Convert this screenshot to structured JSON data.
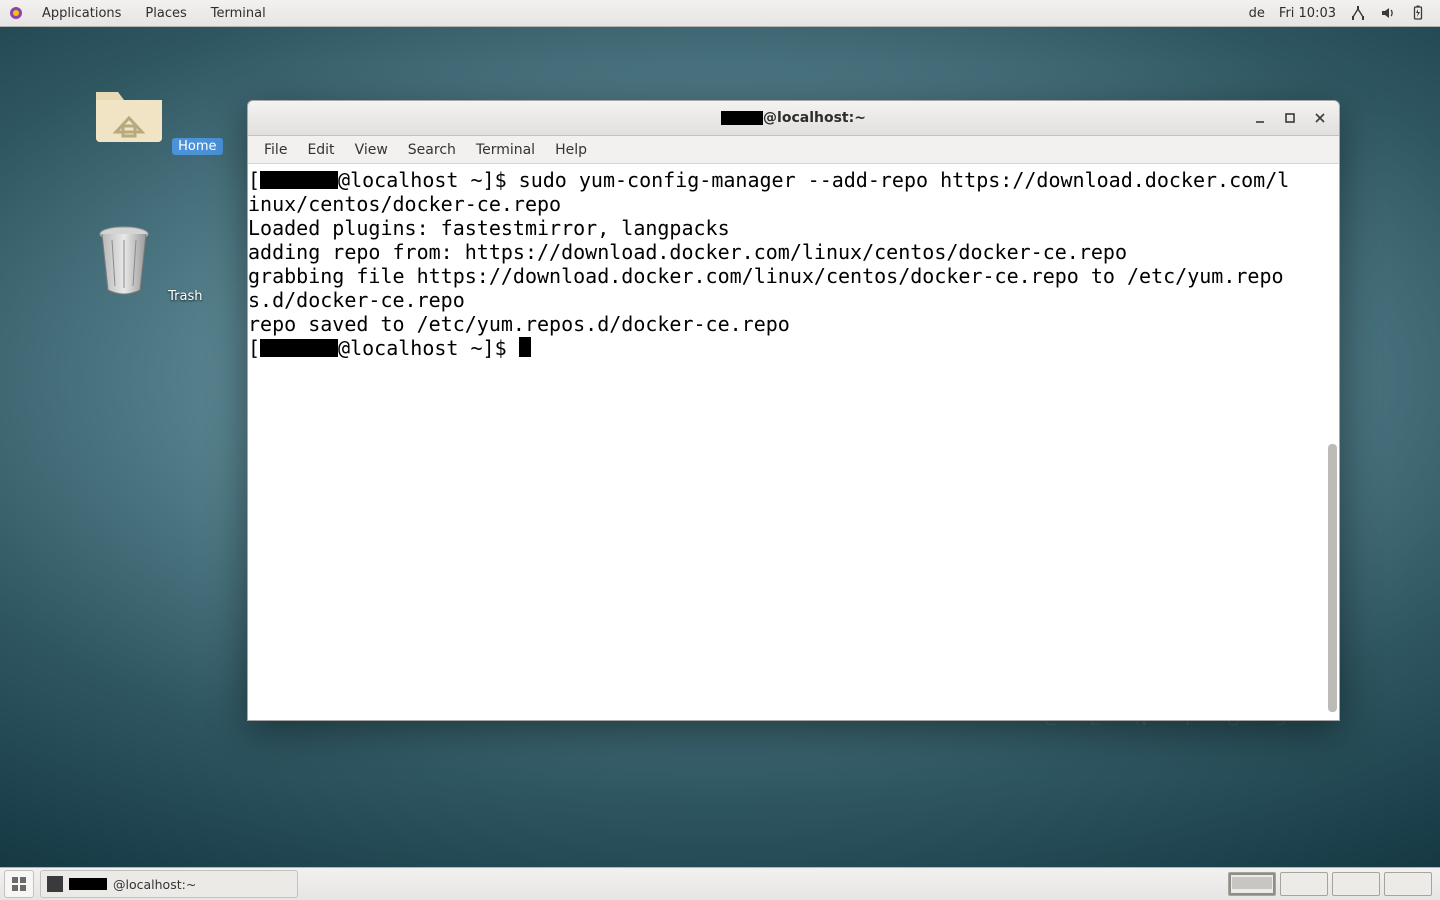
{
  "topbar": {
    "menus": [
      "Applications",
      "Places",
      "Terminal"
    ],
    "lang": "de",
    "clock": "Fri 10:03"
  },
  "desktop": {
    "home_label": "Home",
    "trash_label": "Trash"
  },
  "watermark": "C E N T O S",
  "window": {
    "title_suffix": "@localhost:~",
    "menubar": [
      "File",
      "Edit",
      "View",
      "Search",
      "Terminal",
      "Help"
    ],
    "username_redacted": true,
    "prompt_host": "@localhost ~]$ ",
    "lines": [
      {
        "prompt": true,
        "text": "sudo yum-config-manager --add-repo https://download.docker.com/l"
      },
      {
        "text": "inux/centos/docker-ce.repo"
      },
      {
        "text": "Loaded plugins: fastestmirror, langpacks"
      },
      {
        "text": "adding repo from: https://download.docker.com/linux/centos/docker-ce.repo"
      },
      {
        "text": "grabbing file https://download.docker.com/linux/centos/docker-ce.repo to /etc/yum.repo"
      },
      {
        "text": "s.d/docker-ce.repo"
      },
      {
        "text": "repo saved to /etc/yum.repos.d/docker-ce.repo"
      },
      {
        "prompt": true,
        "cursor": true,
        "text": ""
      }
    ]
  },
  "taskbar": {
    "task_suffix": "@localhost:~"
  }
}
